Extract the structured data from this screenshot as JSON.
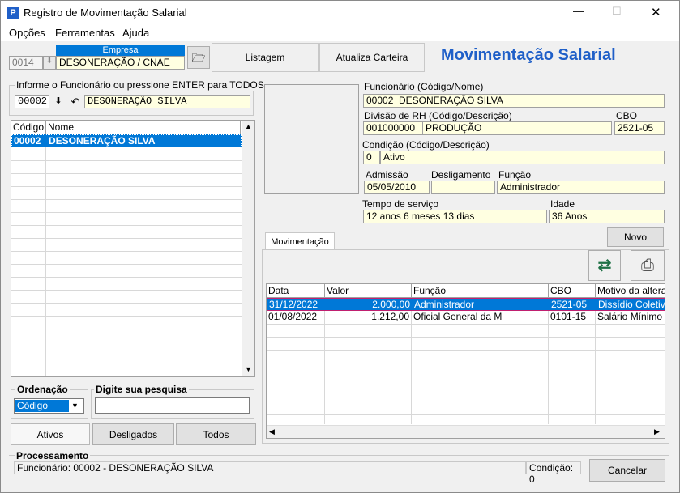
{
  "window": {
    "title": "Registro de Movimentação Salarial",
    "controls": {
      "minimize": "—",
      "maximize": "☐",
      "close": "✕"
    }
  },
  "menu": [
    "Opções",
    "Ferramentas",
    "Ajuda"
  ],
  "empresa": {
    "label": "Empresa",
    "code": "0014",
    "name": "DESONERAÇÃO / CNAE"
  },
  "toolbar": {
    "listagem": "Listagem",
    "atualiza": "Atualiza Carteira"
  },
  "page_title": "Movimentação Salarial",
  "search": {
    "legend": "Informe o Funcionário ou pressione ENTER para TODOS",
    "code": "00002",
    "name": "DESONERAÇÃO SILVA"
  },
  "employee_list": {
    "columns": [
      "Código",
      "Nome"
    ],
    "rows": [
      {
        "code": "00002",
        "name": "DESONERAÇÃO SILVA"
      }
    ]
  },
  "ordenacao": {
    "legend": "Ordenação",
    "selected": "Código"
  },
  "pesquisa": {
    "legend": "Digite sua pesquisa",
    "value": ""
  },
  "filter_tabs": [
    "Ativos",
    "Desligados",
    "Todos"
  ],
  "details": {
    "funcionario_label": "Funcionário (Código/Nome)",
    "funcionario_code": "00002",
    "funcionario_name": "DESONERAÇÃO SILVA",
    "divisao_label": "Divisão de RH (Código/Descrição)",
    "divisao_code": "001000000",
    "divisao_desc": "PRODUÇÃO",
    "cbo_label": "CBO",
    "cbo": "2521-05",
    "condicao_label": "Condição (Código/Descrição)",
    "condicao_code": "0",
    "condicao_desc": "Ativo",
    "admissao_label": "Admissão",
    "admissao": "05/05/2010",
    "desligamento_label": "Desligamento",
    "desligamento": "",
    "funcao_label": "Função",
    "funcao": "Administrador",
    "tempo_label": "Tempo de serviço",
    "tempo": "12 anos 6 meses 13 dias",
    "idade_label": "Idade",
    "idade": "36 Anos"
  },
  "mov": {
    "tab": "Movimentação",
    "novo": "Novo",
    "columns": [
      "Data",
      "Valor",
      "Função",
      "CBO",
      "Motivo da altera"
    ],
    "rows": [
      {
        "data": "31/12/2022",
        "valor": "2.000,00",
        "funcao": "Administrador",
        "cbo": "2521-05",
        "motivo": "Dissídio Coletivo"
      },
      {
        "data": "01/08/2022",
        "valor": "1.212,00",
        "funcao": "Oficial General da M",
        "cbo": "0101-15",
        "motivo": "Salário Mínimo"
      }
    ]
  },
  "processamento": {
    "legend": "Processamento",
    "status": "Funcionário: 00002 - DESONERAÇÃO SILVA",
    "condicao": "Condição: 0",
    "cancelar": "Cancelar"
  },
  "colors": {
    "accent": "#0078d7",
    "title_blue": "#1f5fc8",
    "field_bg": "#ffffe1"
  }
}
